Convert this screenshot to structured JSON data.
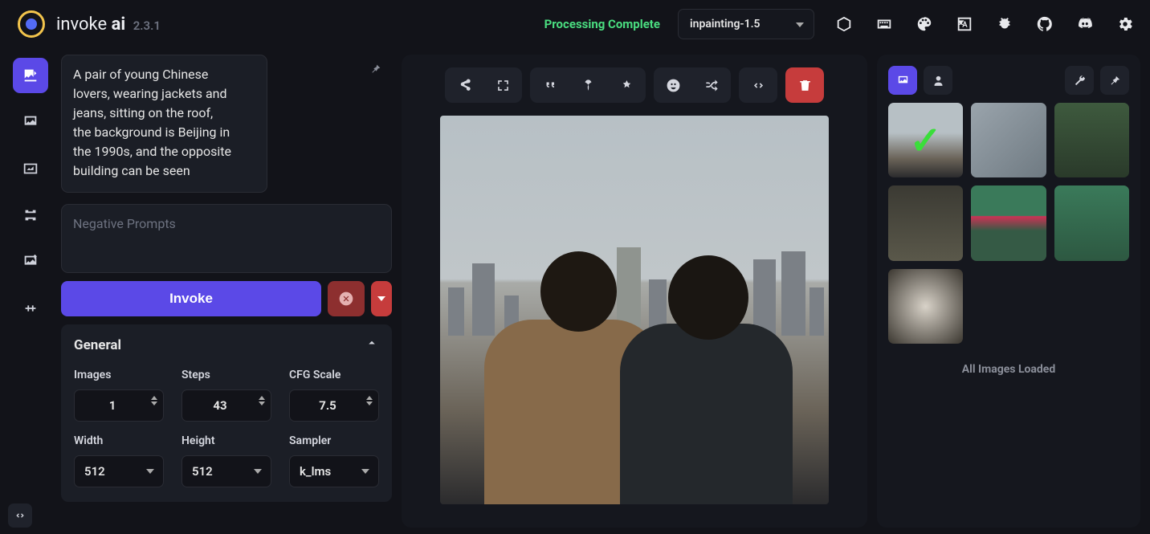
{
  "app": {
    "name_a": "invoke",
    "name_b": "ai",
    "version": "2.3.1"
  },
  "header": {
    "status": "Processing Complete",
    "model_selected": "inpainting-1.5",
    "icons": [
      "cube",
      "keyboard",
      "palette",
      "language",
      "bug",
      "github",
      "discord",
      "settings"
    ]
  },
  "rail": {
    "items": [
      "txt2img",
      "img2img",
      "gallery",
      "nodes",
      "upscale",
      "training"
    ],
    "active_index": 0
  },
  "prompt": {
    "text": "A pair of young Chinese lovers, wearing jackets and jeans, sitting on the roof, the background is Beijing in the 1990s, and the opposite building can be seen",
    "negative_placeholder": "Negative Prompts",
    "invoke_label": "Invoke"
  },
  "general": {
    "title": "General",
    "images": {
      "label": "Images",
      "value": "1"
    },
    "steps": {
      "label": "Steps",
      "value": "43"
    },
    "cfg": {
      "label": "CFG Scale",
      "value": "7.5"
    },
    "width": {
      "label": "Width",
      "value": "512"
    },
    "height": {
      "label": "Height",
      "value": "512"
    },
    "sampler": {
      "label": "Sampler",
      "value": "k_lms"
    }
  },
  "canvas": {
    "toolbar_groups": [
      [
        "share",
        "fullscreen"
      ],
      [
        "quote",
        "seed",
        "variation"
      ],
      [
        "face",
        "shuffle"
      ],
      [
        "code"
      ]
    ],
    "delete_label": "delete"
  },
  "gallery": {
    "tabs": [
      "images",
      "user"
    ],
    "active_tab": 0,
    "tools": [
      "wrench",
      "pin"
    ],
    "thumbs": [
      {
        "selected": true,
        "bg": "linear-gradient(180deg,#b7c0c5 40%,#6a6358 75%,#2b2b2d 100%)"
      },
      {
        "selected": false,
        "bg": "linear-gradient(135deg,#9aa4ac,#6f7a82)"
      },
      {
        "selected": false,
        "bg": "linear-gradient(180deg,#3e5a3e,#2a3a2a)"
      },
      {
        "selected": false,
        "bg": "linear-gradient(180deg,#3b3a33,#5a584a)"
      },
      {
        "selected": false,
        "bg": "linear-gradient(180deg,#3a7a5a 40%,#cc3355 41%,#355a45 60%)"
      },
      {
        "selected": false,
        "bg": "linear-gradient(180deg,#3a7a5a,#2d5841)"
      },
      {
        "selected": false,
        "bg": "radial-gradient(circle,#d8d2c8,#3a362f)"
      }
    ],
    "footer": "All Images Loaded"
  }
}
